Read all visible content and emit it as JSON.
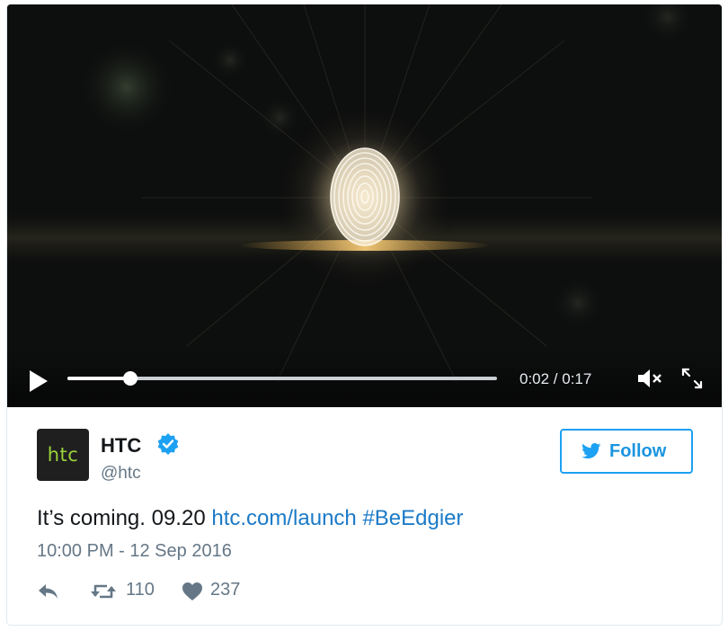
{
  "video": {
    "elapsed": "0:02",
    "duration": "0:17",
    "time_display": "0:02 / 0:17",
    "progress_fraction": 0.146,
    "muted": true
  },
  "author": {
    "avatar_text": "htc",
    "name": "HTC",
    "handle": "@htc",
    "verified": true
  },
  "follow": {
    "label": "Follow"
  },
  "tweet": {
    "text_plain": "It’s coming. 09.20 ",
    "link": "htc.com/launch",
    "hashtag": "#BeEdgier",
    "timestamp": "10:00 PM - 12 Sep 2016"
  },
  "actions": {
    "retweet_count": "110",
    "like_count": "237"
  },
  "colors": {
    "accent": "#1da1f2",
    "link": "#1b7ac7",
    "muted_text": "#657786",
    "avatar_text": "#9ad33a"
  },
  "icons": {
    "play": "play-icon",
    "mute": "mute-icon",
    "fullscreen": "fullscreen-icon",
    "verified": "verified-badge-icon",
    "bird": "twitter-bird-icon",
    "reply": "reply-icon",
    "retweet": "retweet-icon",
    "like": "heart-icon"
  }
}
